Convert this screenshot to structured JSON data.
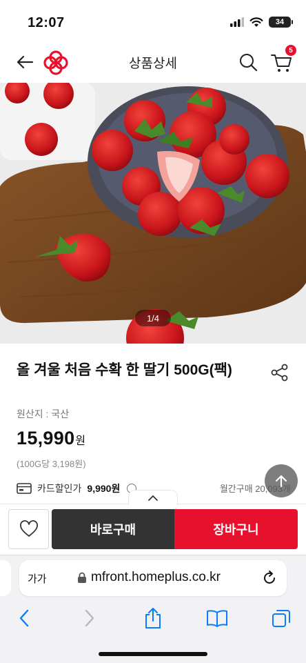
{
  "status_bar": {
    "time": "12:07",
    "battery": "34"
  },
  "header": {
    "title": "상품상세",
    "cart_count": "5"
  },
  "gallery": {
    "counter": "1/4"
  },
  "product": {
    "title": "올 겨울 처음 수확 한 딸기 500G(팩)",
    "origin": "원산지 : 국산",
    "price": "15,990",
    "price_unit": "원",
    "unit_price": "(100G당 3,198원)",
    "card_discount_label": "카드할인가",
    "card_discount_price": "9,990원",
    "monthly_purchase": "월간구매 20,093개"
  },
  "actions": {
    "buy_now": "바로구매",
    "add_to_cart": "장바구니"
  },
  "browser": {
    "aa_label": "가가",
    "url": "mfront.homeplus.co.kr"
  },
  "colors": {
    "accent": "#e8112d",
    "dark_button": "#333333",
    "ios_blue": "#0a7aff"
  }
}
